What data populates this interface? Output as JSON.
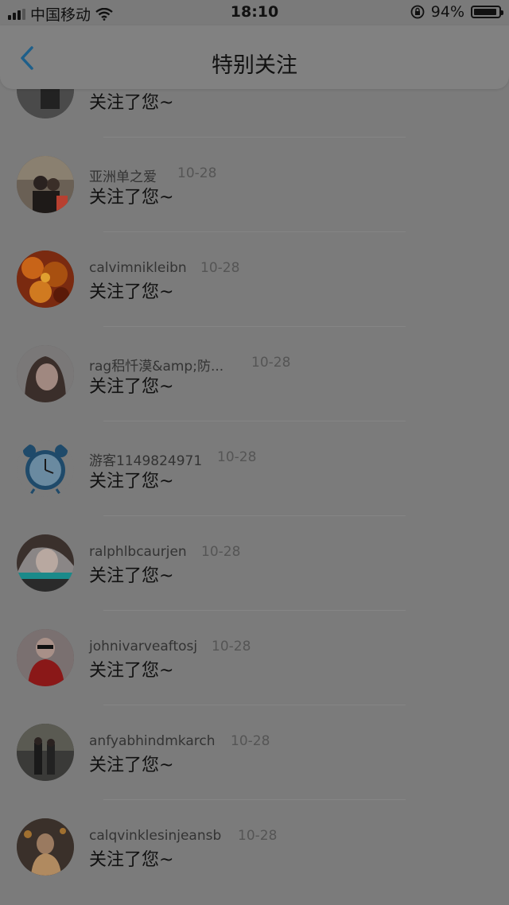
{
  "status_bar": {
    "carrier": "中国移动",
    "time": "18:10",
    "battery_percent": "94%",
    "battery_level": 0.94
  },
  "nav": {
    "title": "特别关注",
    "back_icon": "chevron-left-icon"
  },
  "items": [
    {
      "name": "",
      "date": "",
      "action": "关注了您~",
      "avatar": "avatar-photo"
    },
    {
      "name": "亚洲单之爱",
      "date": "10-28",
      "action": "关注了您~",
      "avatar": "avatar-photo"
    },
    {
      "name": "calvimnikleibn",
      "date": "10-28",
      "action": "关注了您~",
      "avatar": "avatar-photo"
    },
    {
      "name": "rag稆忏漠&amp;防...",
      "date": "10-28",
      "action": "关注了您~",
      "avatar": "avatar-photo"
    },
    {
      "name": "游客1149824971",
      "date": "10-28",
      "action": "关注了您~",
      "avatar": "alarm-clock-icon"
    },
    {
      "name": "ralphlbcaurjen",
      "date": "10-28",
      "action": "关注了您~",
      "avatar": "avatar-photo"
    },
    {
      "name": "johnivarveaftosj",
      "date": "10-28",
      "action": "关注了您~",
      "avatar": "avatar-photo"
    },
    {
      "name": "anfyabhindmkarch",
      "date": "10-28",
      "action": "关注了您~",
      "avatar": "avatar-photo"
    },
    {
      "name": "calqvinklesinjeansb",
      "date": "10-28",
      "action": "关注了您~",
      "avatar": "avatar-photo"
    }
  ]
}
